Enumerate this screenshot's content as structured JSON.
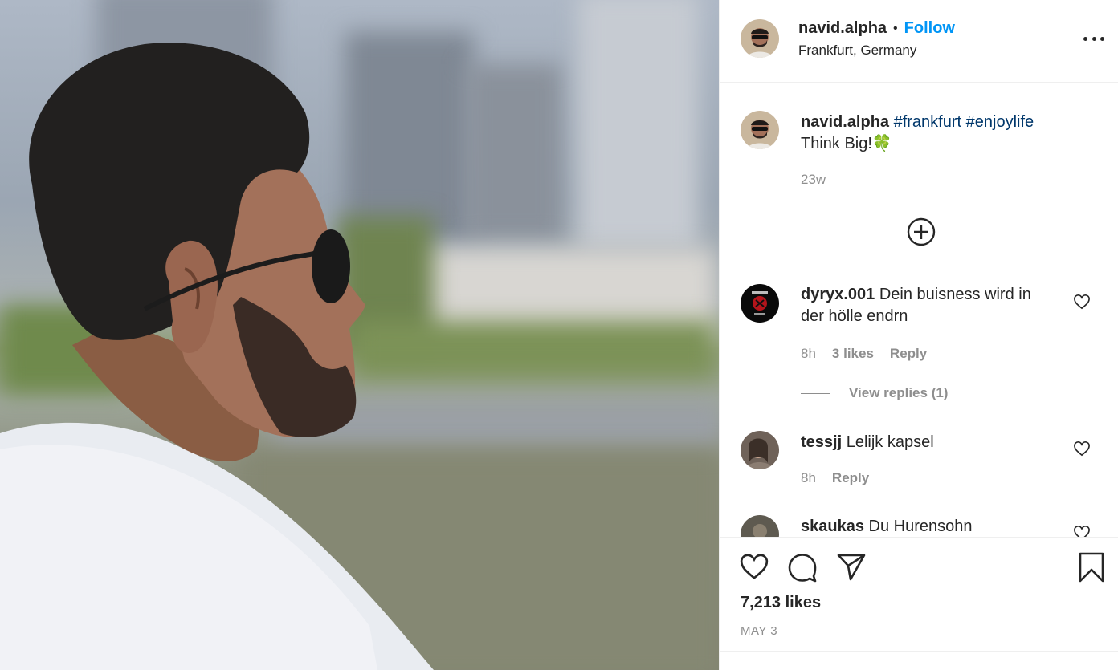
{
  "post": {
    "username": "navid.alpha",
    "follow_label": "Follow",
    "separator": "•",
    "location": "Frankfurt, Germany"
  },
  "caption": {
    "username": "navid.alpha",
    "hashtags": "#frankfurt #enjoylife",
    "text": "Think Big!🍀",
    "age": "23w"
  },
  "comments": [
    {
      "username": "dyryx.001",
      "text": "Dein buisness wird in der hölle endrn",
      "age": "8h",
      "likes": "3 likes",
      "reply": "Reply"
    },
    {
      "username": "tessjj",
      "text": "Lelijk kapsel",
      "age": "8h",
      "reply": "Reply"
    },
    {
      "username": "skaukas",
      "text": "Du Hurensohn"
    }
  ],
  "view_replies": "View replies (1)",
  "footer": {
    "likes": "7,213 likes",
    "date": "MAY 3"
  },
  "colors": {
    "link": "#0095f6",
    "hashtag": "#00376b",
    "muted": "#8e8e8e",
    "text": "#262626"
  }
}
